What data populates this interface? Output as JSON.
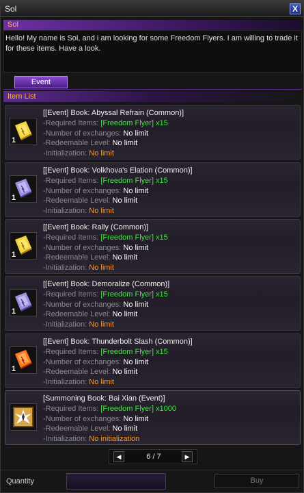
{
  "window": {
    "title": "Sol",
    "close_label": "X"
  },
  "npc": {
    "name": "Sol",
    "dialog": "Hello! My name is Sol, and i am looking for some Freedom Flyers. I am willing to trade it for these items. Have a look."
  },
  "tabs": [
    {
      "label": "Event",
      "active": true
    }
  ],
  "list_header": "Item List",
  "labels": {
    "required": "-Required Items:",
    "exchanges": "-Number of exchanges:",
    "level": "-Redeemable Level:",
    "init": "-Initialization:"
  },
  "items": [
    {
      "name": "[[Event] Book: Abyssal Refrain (Common)]",
      "icon": "gold-book-icon",
      "count": "1",
      "required": "[Freedom Flyer] x15",
      "exchanges": "No limit",
      "level": "No limit",
      "init": "No limit"
    },
    {
      "name": "[[Event] Book: Volkhova's Elation (Common)]",
      "icon": "violet-book-icon",
      "count": "1",
      "required": "[Freedom Flyer] x15",
      "exchanges": "No limit",
      "level": "No limit",
      "init": "No limit"
    },
    {
      "name": "[[Event] Book: Rally (Common)]",
      "icon": "gold-book-icon",
      "count": "1",
      "required": "[Freedom Flyer] x15",
      "exchanges": "No limit",
      "level": "No limit",
      "init": "No limit"
    },
    {
      "name": "[[Event] Book: Demoralize (Common)]",
      "icon": "violet-book-icon",
      "count": "1",
      "required": "[Freedom Flyer] x15",
      "exchanges": "No limit",
      "level": "No limit",
      "init": "No limit"
    },
    {
      "name": "[[Event] Book: Thunderbolt Slash (Common)]",
      "icon": "red-book-icon",
      "count": "1",
      "required": "[Freedom Flyer] x15",
      "exchanges": "No limit",
      "level": "No limit",
      "init": "No limit"
    },
    {
      "name": "[Summoning Book: Bai Xian (Event)]",
      "icon": "summoning-book-icon",
      "count": "",
      "required": "[Freedom Flyer] x1000",
      "exchanges": "No limit",
      "level": "No limit",
      "init": "No initialization"
    }
  ],
  "pager": {
    "text": "6 / 7",
    "prev_icon": "triangle-left-icon",
    "next_icon": "triangle-right-icon"
  },
  "footer": {
    "quantity_label": "Quantity",
    "quantity_value": "",
    "buy_label": "Buy"
  },
  "colors": {
    "accent_purple": "#6e2fa8",
    "label_orange": "#ffb347",
    "green": "#3ee83e",
    "orange": "#ff9a1e"
  }
}
